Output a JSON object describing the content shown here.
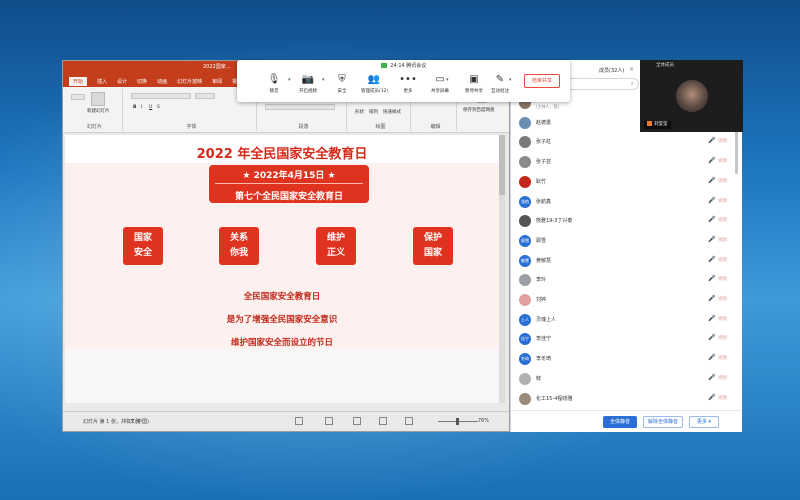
{
  "colors": {
    "accent": "#e0331f",
    "ppt_red": "#c43e1c",
    "blue": "#2a6fd4"
  },
  "ppt": {
    "doc_title": "2022国家...",
    "tabs": [
      "开始",
      "插入",
      "设计",
      "切换",
      "动画",
      "幻灯片放映",
      "审阅",
      "视图"
    ],
    "ribbon": {
      "group_slides": "幻灯片",
      "group_font": "字体",
      "group_paragraph": "段落",
      "group_drawing": "绘图",
      "group_editing": "编辑",
      "btn_new_slide": "新建幻灯片",
      "btn_shapes": "形状",
      "btn_arrange": "排列",
      "btn_quickstyle": "快速样式",
      "btn_save": "保存到百度网盘",
      "font_size_b": "B",
      "font_size_i": "I",
      "font_size_u": "U",
      "font_size_s": "S"
    },
    "slide": {
      "title": "2022 年全民国家安全教育日",
      "date": "★ 2022年4月15日 ★",
      "subtitle": "第七个全民国家安全教育日",
      "pillars": [
        {
          "line1": "国家",
          "line2": "安全"
        },
        {
          "line1": "关系",
          "line2": "你我"
        },
        {
          "line1": "维护",
          "line2": "正义"
        },
        {
          "line1": "保护",
          "line2": "国家"
        }
      ],
      "text1": "全民国家安全教育日",
      "text2": "是为了增强全民国家安全意识",
      "text3": "维护国家安全而设立的节日"
    },
    "status": {
      "slide_count": "幻灯片 第 1 张，共 17 张",
      "language": "中文(中国)",
      "zoom": "76%"
    }
  },
  "meeting": {
    "time": "24:14",
    "name": "腾讯会议",
    "buttons": [
      {
        "icon": "mic-icon",
        "glyph": "🎙",
        "label": "静音"
      },
      {
        "icon": "camera-icon",
        "glyph": "📷",
        "label": "开启视频"
      },
      {
        "icon": "shield-icon",
        "glyph": "⛨",
        "label": "安全"
      },
      {
        "icon": "members-icon",
        "glyph": "👥",
        "label": "管理成员(32)"
      },
      {
        "icon": "more-icon",
        "glyph": "•••",
        "label": "更多"
      },
      {
        "icon": "share-icon",
        "glyph": "▭",
        "label": "共享屏幕"
      },
      {
        "icon": "stop-share-icon",
        "glyph": "▣",
        "label": "暂停共享"
      },
      {
        "icon": "annotate-icon",
        "glyph": "✎",
        "label": "互动批注"
      }
    ],
    "end_button": "结束共享",
    "video": {
      "title": "全体成员",
      "name": "刘莹莹"
    }
  },
  "member_panel": {
    "title": "成员(32人)",
    "close": "✕",
    "search_icon": "⌕",
    "members": [
      {
        "name": "刘莹莹",
        "sub": "(主持人，我)",
        "avatar": "",
        "color": "#8a7466"
      },
      {
        "name": "赵德勇",
        "sub": "",
        "avatar": "",
        "color": "#6a8fb3"
      },
      {
        "name": "张子虹",
        "sub": "",
        "avatar": "",
        "color": "#7a7a7a"
      },
      {
        "name": "张子芸",
        "sub": "",
        "avatar": "",
        "color": "#8b8b8b"
      },
      {
        "name": "耿竹",
        "sub": "",
        "avatar": "",
        "color": "#c4281c"
      },
      {
        "name": "张航鑫",
        "sub": "",
        "avatar": "张航",
        "color": "#2a6fd4"
      },
      {
        "name": "熊雅19-3丁兴泰",
        "sub": "",
        "avatar": "",
        "color": "#555555"
      },
      {
        "name": "顾雪",
        "sub": "",
        "avatar": "顾雪",
        "color": "#2a6fd4"
      },
      {
        "name": "黄敏慧",
        "sub": "",
        "avatar": "敏慧",
        "color": "#2a6fd4"
      },
      {
        "name": "李玲",
        "sub": "",
        "avatar": "",
        "color": "#9aa0a6"
      },
      {
        "name": "刘婷",
        "sub": "",
        "avatar": "",
        "color": "#e0a0a0"
      },
      {
        "name": "灵魂上人",
        "sub": "",
        "avatar": "上人",
        "color": "#2a6fd4"
      },
      {
        "name": "李佳宁",
        "sub": "",
        "avatar": "佳宁",
        "color": "#2a6fd4"
      },
      {
        "name": "李冬琦",
        "sub": "",
        "avatar": "冬琦",
        "color": "#2a6fd4"
      },
      {
        "name": "鲜",
        "sub": "",
        "avatar": "",
        "color": "#b0b0b0"
      },
      {
        "name": "化工15-4程晓雅",
        "sub": "",
        "avatar": "",
        "color": "#9a8a7a"
      }
    ],
    "mic_glyph": "🎤",
    "cam_label": "视频",
    "footer": {
      "mute_all": "全体静音",
      "unmute_all": "解除全体静音",
      "more": "更多 ▾"
    }
  }
}
